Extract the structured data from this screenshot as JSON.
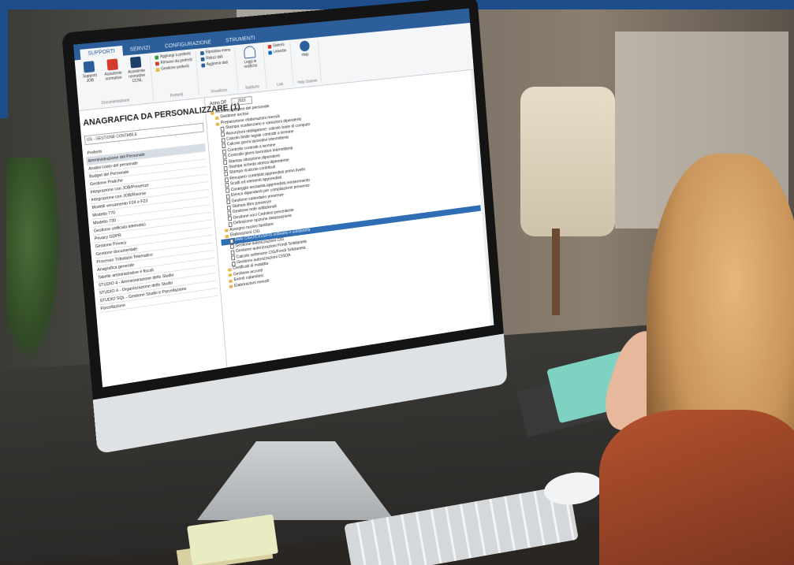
{
  "tabs": [
    "SUPPORTI",
    "SERVIZI",
    "CONFIGURAZIONE",
    "STRUMENTI"
  ],
  "ribbon": {
    "documentazione": {
      "buttons": [
        "Supporti JOB",
        "Assistente normative",
        "Assistente normative CCNL"
      ],
      "name": "Documentazione"
    },
    "preferiti": {
      "items": [
        "Aggiungi a preferiti",
        "Rimuovi da preferiti",
        "Gestione preferiti"
      ],
      "name": "Preferiti"
    },
    "visualizza": {
      "items": [
        "Ripristina menu",
        "Riduci dati",
        "Aggiorna dati"
      ],
      "name": "Visualizza"
    },
    "notifiche": {
      "button": "Leggi le notifiche",
      "name": "Notifiche"
    },
    "link": {
      "items": [
        "Sistemi",
        "LinkedIn"
      ],
      "name": "Link"
    },
    "help": {
      "button": "Help",
      "name": "Help Sistemi"
    }
  },
  "page_title": "ANAGRAFICA DA PERSONALIZZARE (1)",
  "dropdown": "GS - GESTIONE CONTABILE",
  "menu": [
    "Preferiti",
    "Amministrazione del Personale",
    "Analisi costo del personale",
    "Budget del Personale",
    "Gestione Pratiche",
    "Integrazione con JOB/Presenze",
    "Integrazione con JOB/Risorse",
    "Modelli versamento F24 e F23",
    "Modello 770",
    "Modello 730",
    "Gestione unificata telematici",
    "Privacy GDPR",
    "Gestione Privacy",
    "Gestione documentale",
    "Processo Tributario Telematico",
    "Anagrafica generale",
    "Tabelle amministrative e fiscali",
    "STUDIO 4 - Amministrazione dello Studio",
    "STUDIO 4 - Organizzazione dello Studio",
    "STUDIO SQL - Gestione Studio e Parcellazione",
    "Parcellazione"
  ],
  "year_label": "Anno DF",
  "year_value": "2023",
  "tree": [
    {
      "label": "Amministrazione del personale",
      "kind": "folder"
    },
    {
      "label": "Gestione archivi",
      "kind": "folder"
    },
    {
      "label": "Preparazione elaborazioni mensili",
      "kind": "folder"
    },
    {
      "label": "Stampa scadenzario e variazioni dipendenti",
      "kind": "doc"
    },
    {
      "label": "Assunzioni obbligatorie: calcolo base di computo",
      "kind": "doc"
    },
    {
      "label": "Calcolo limite legale contratti a termine",
      "kind": "doc"
    },
    {
      "label": "Calcolo giorni lavorativi intermittenti",
      "kind": "doc"
    },
    {
      "label": "Controllo contratti a termine",
      "kind": "doc"
    },
    {
      "label": "Controllo giorni lavoratori intermittenti",
      "kind": "doc"
    },
    {
      "label": "Stampa situazione dipendenti",
      "kind": "doc"
    },
    {
      "label": "Stampa scheda storica dipendente",
      "kind": "doc"
    },
    {
      "label": "Stampa ricalcolo contributi",
      "kind": "doc"
    },
    {
      "label": "Recupero contributi apprendisti primo livello",
      "kind": "doc"
    },
    {
      "label": "Scatti ed elementi apprendisti",
      "kind": "doc"
    },
    {
      "label": "Conteggio anzianità,apprendisti,reinserimento",
      "kind": "doc"
    },
    {
      "label": "Elenco dipendenti per compilazione presenze",
      "kind": "doc"
    },
    {
      "label": "Gestione calendario presenze",
      "kind": "doc"
    },
    {
      "label": "Stampa libro presenze",
      "kind": "doc"
    },
    {
      "label": "Gestione note addizionali",
      "kind": "doc"
    },
    {
      "label": "Gestione voci Cedolino precedente",
      "kind": "doc"
    },
    {
      "label": "Definizione opzione detassazione",
      "kind": "doc"
    },
    {
      "label": "Assegno nucleo familiare",
      "kind": "folder"
    },
    {
      "label": "Elaborazioni CIG",
      "kind": "folder"
    },
    {
      "label": "Invio CIGO/CIGS/FIS ordinario e solidarietà",
      "kind": "doc",
      "highlight": true
    },
    {
      "label": "Gestione autorizzazioni CIG",
      "kind": "doc"
    },
    {
      "label": "Gestione autorizzazioni Fondi Solidarietà",
      "kind": "doc"
    },
    {
      "label": "Calcolo settimane CIG/Fondi Solidarietà",
      "kind": "doc"
    },
    {
      "label": "Gestione autorizzazioni CISOA",
      "kind": "doc"
    },
    {
      "label": "Certificati di malattia",
      "kind": "folder"
    },
    {
      "label": "Gestione acconti",
      "kind": "folder"
    },
    {
      "label": "Eventi calamitosi",
      "kind": "folder"
    },
    {
      "label": "Elaborazioni mensili",
      "kind": "folder"
    }
  ],
  "colors": {
    "brand_blue": "#2c5f9a",
    "highlight": "#2f6db5",
    "folder": "#e8b84a"
  }
}
